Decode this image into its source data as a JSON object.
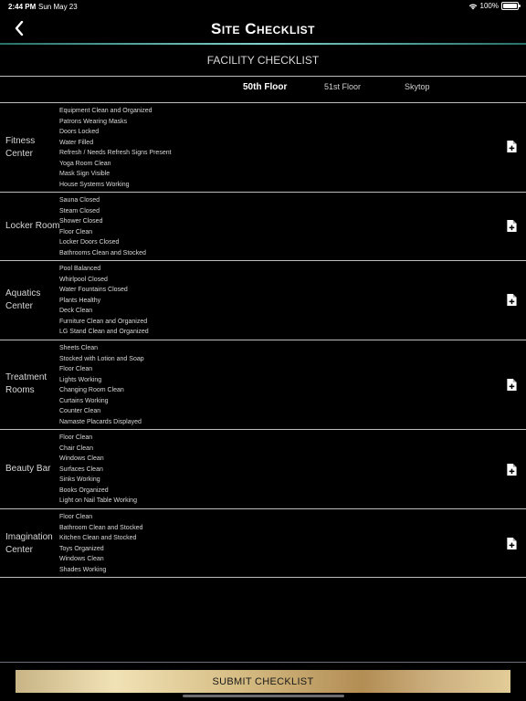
{
  "status": {
    "time": "2:44 PM",
    "date": "Sun May 23",
    "battery": "100%"
  },
  "nav": {
    "title": "Site Checklist"
  },
  "section_title": "FACILITY CHECKLIST",
  "tabs": [
    {
      "label": "50th Floor",
      "active": true
    },
    {
      "label": "51st Floor",
      "active": false
    },
    {
      "label": "Skytop",
      "active": false
    }
  ],
  "rows": [
    {
      "label": "Fitness Center",
      "items": [
        "Equipment Clean and Organized",
        "Patrons Wearing Masks",
        "Doors Locked",
        "Water Filled",
        "Refresh / Needs Refresh Signs Present",
        "Yoga Room Clean",
        "Mask Sign Visible",
        "House Systems Working"
      ]
    },
    {
      "label": "Locker Room",
      "items": [
        "Sauna Closed",
        "Steam Closed",
        "Shower Closed",
        "Floor Clean",
        "Locker Doors Closed",
        "Bathrooms Clean and Stocked"
      ]
    },
    {
      "label": "Aquatics Center",
      "items": [
        "Pool Balanced",
        "Whirlpool Closed",
        "Water Fountains Closed",
        "Plants Healthy",
        "Deck Clean",
        "Furniture Clean and Organized",
        "LG Stand Clean and Organized"
      ]
    },
    {
      "label": "Treatment Rooms",
      "items": [
        "Sheets Clean",
        "Stocked with Lotion and Soap",
        "Floor Clean",
        "Lights Working",
        "Changing Room Clean",
        "Curtains Working",
        "Counter Clean",
        "Namaste Placards Displayed"
      ]
    },
    {
      "label": "Beauty Bar",
      "items": [
        "Floor Clean",
        "Chair Clean",
        "Windows Clean",
        "Surfaces Clean",
        "Sinks Working",
        "Books Organized",
        "Light on Nail Table Working"
      ]
    },
    {
      "label": "Imagination Center",
      "items": [
        "Floor Clean",
        "Bathroom Clean and Stocked",
        "Kitchen Clean and Stocked",
        "Toys Organized",
        "Windows Clean",
        "Shades Working"
      ]
    }
  ],
  "submit_label": "SUBMIT CHECKLIST"
}
